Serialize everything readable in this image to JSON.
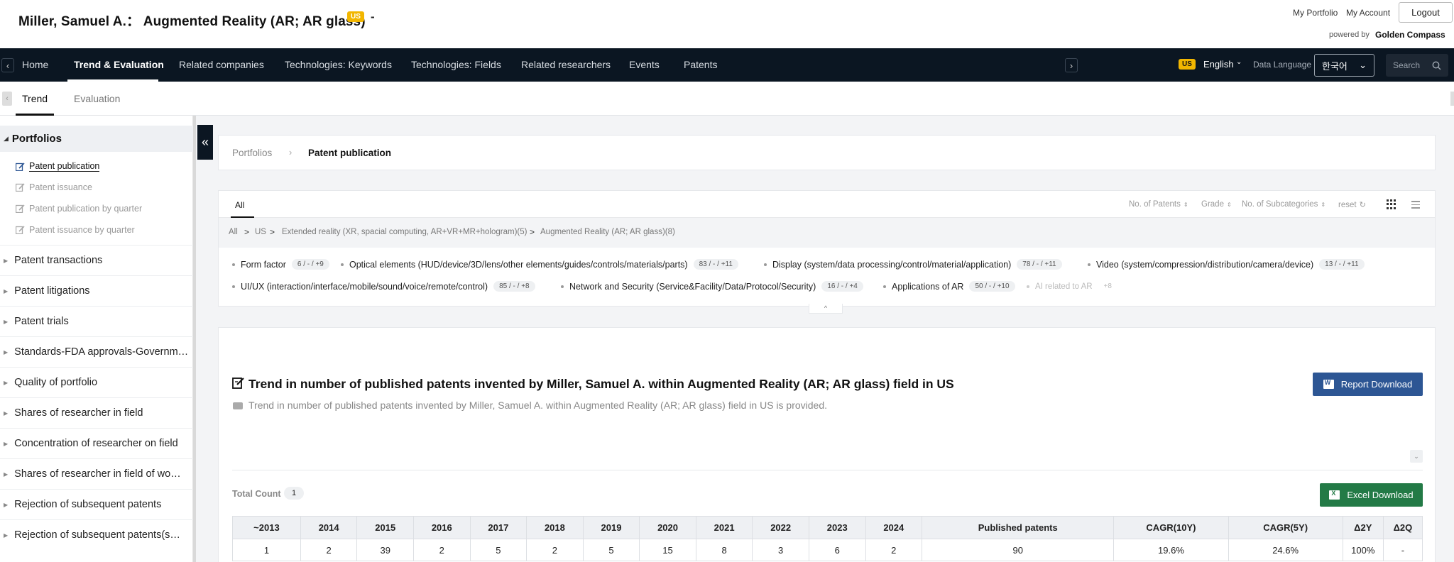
{
  "header": {
    "title": "Miller, Samuel A.： Augmented Reality (AR; AR glass)",
    "country_badge": "US",
    "dash": "-",
    "my_portfolio": "My Portfolio",
    "my_account": "My Account",
    "logout": "Logout",
    "powered_by": "powered by",
    "brand": "Golden Compass"
  },
  "nav": {
    "items": [
      {
        "label": "Home"
      },
      {
        "label": "Trend & Evaluation"
      },
      {
        "label": "Related companies"
      },
      {
        "label": "Technologies: Keywords"
      },
      {
        "label": "Technologies: Fields"
      },
      {
        "label": "Related researchers"
      },
      {
        "label": "Events"
      },
      {
        "label": "Patents"
      }
    ],
    "prev_arrow": "‹",
    "next_arrow": "›",
    "lang_badge": "US",
    "language": "English",
    "data_language_label": "Data Language",
    "data_language_value": "한국어",
    "search_placeholder": "Search"
  },
  "subtabs": {
    "items": [
      {
        "label": "Trend"
      },
      {
        "label": "Evaluation"
      }
    ]
  },
  "sidebar": {
    "section": "Portfolios",
    "sub_items": [
      {
        "label": "Patent publication"
      },
      {
        "label": "Patent issuance"
      },
      {
        "label": "Patent publication by quarter"
      },
      {
        "label": "Patent issuance by quarter"
      }
    ],
    "items": [
      {
        "label": "Patent transactions"
      },
      {
        "label": "Patent litigations"
      },
      {
        "label": "Patent trials"
      },
      {
        "label": "Standards-FDA approvals-Governm…"
      },
      {
        "label": "Quality of portfolio"
      },
      {
        "label": "Shares of researcher in field"
      },
      {
        "label": "Concentration of researcher on field"
      },
      {
        "label": "Shares of researcher in field of wo…"
      },
      {
        "label": "Rejection of subsequent patents"
      },
      {
        "label": "Rejection of subsequent patents(s…"
      }
    ],
    "collapse_icon": "«"
  },
  "breadcrumb": {
    "root": "Portfolios",
    "sep": "›",
    "current": "Patent publication"
  },
  "filters": {
    "tab_all": "All",
    "sort_patents": "No. of Patents",
    "sort_grade": "Grade",
    "sort_subcats": "No. of Subcategories",
    "reset": "reset",
    "path": [
      "All",
      "US",
      "Extended reality (XR, spacial computing, AR+VR+MR+hologram)(5)",
      "Augmented Reality (AR; AR glass)(8)"
    ],
    "path_sep": ">",
    "chips": [
      {
        "label": "Form factor",
        "count": "6 / - / +9"
      },
      {
        "label": "Optical elements (HUD/device/3D/lens/other elements/guides/controls/materials/parts)",
        "count": "83 / - / +11"
      },
      {
        "label": "Display (system/data processing/control/material/application)",
        "count": "78 / - / +11"
      },
      {
        "label": "Video (system/compression/distribution/camera/device)",
        "count": "13 / - / +11"
      },
      {
        "label": "UI/UX (interaction/interface/mobile/sound/voice/remote/control)",
        "count": "85 / - / +8"
      },
      {
        "label": "Network and Security (Service&Facility/Data/Protocol/Security)",
        "count": "16 / - / +4"
      },
      {
        "label": "Applications of AR",
        "count": "50 / - / +10"
      },
      {
        "label": "AI related to AR",
        "count": "+8"
      }
    ],
    "fold_icon": "^"
  },
  "content": {
    "title": "Trend in number of published patents invented by Miller, Samuel A. within Augmented Reality (AR; AR glass) field in US",
    "description": "Trend in number of published patents invented by Miller, Samuel A. within Augmented Reality (AR; AR glass) field in US is provided.",
    "report_download": "Report Download",
    "excel_download": "Excel Download",
    "total_count_label": "Total Count",
    "total_count": "1",
    "collapse_chev": "⌄",
    "table": {
      "headers": [
        "~2013",
        "2014",
        "2015",
        "2016",
        "2017",
        "2018",
        "2019",
        "2020",
        "2021",
        "2022",
        "2023",
        "2024",
        "Published patents",
        "CAGR(10Y)",
        "CAGR(5Y)",
        "Δ2Y",
        "Δ2Q"
      ],
      "rows": [
        [
          "1",
          "2",
          "39",
          "2",
          "5",
          "2",
          "5",
          "15",
          "8",
          "3",
          "6",
          "2",
          "90",
          "19.6%",
          "24.6%",
          "100%",
          "-"
        ]
      ]
    }
  }
}
